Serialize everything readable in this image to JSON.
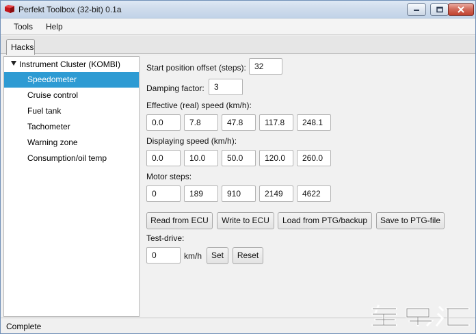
{
  "window": {
    "title": "Perfekt Toolbox (32-bit) 0.1a"
  },
  "menu": {
    "tools": "Tools",
    "help": "Help"
  },
  "tabs": [
    {
      "label": "Hacks"
    }
  ],
  "sidebar": {
    "parent": "Instrument Cluster (KOMBI)",
    "items": [
      {
        "label": "Speedometer"
      },
      {
        "label": "Cruise control"
      },
      {
        "label": "Fuel tank"
      },
      {
        "label": "Tachometer"
      },
      {
        "label": "Warning zone"
      },
      {
        "label": "Consumption/oil temp"
      }
    ],
    "selected": "Speedometer"
  },
  "form": {
    "start_offset": {
      "label": "Start position offset (steps):",
      "value": "32"
    },
    "damping": {
      "label": "Damping factor:",
      "value": "3"
    },
    "effective_speed": {
      "label": "Effective (real) speed (km/h):",
      "values": [
        "0.0",
        "7.8",
        "47.8",
        "117.8",
        "248.1"
      ]
    },
    "displaying_speed": {
      "label": "Displaying speed (km/h):",
      "values": [
        "0.0",
        "10.0",
        "50.0",
        "120.0",
        "260.0"
      ]
    },
    "motor_steps": {
      "label": "Motor steps:",
      "values": [
        "0",
        "189",
        "910",
        "2149",
        "4622"
      ]
    },
    "buttons": {
      "read": "Read from ECU",
      "write": "Write to ECU",
      "load": "Load from PTG/backup",
      "save": "Save to PTG-file"
    },
    "test_drive": {
      "label": "Test-drive:",
      "value": "0",
      "unit": "km/h",
      "set": "Set",
      "reset": "Reset"
    }
  },
  "status": {
    "text": "Complete"
  },
  "colors": {
    "selection": "#2e9bd3",
    "titlebar": "#cfdcec",
    "close_button": "#c1432f"
  }
}
